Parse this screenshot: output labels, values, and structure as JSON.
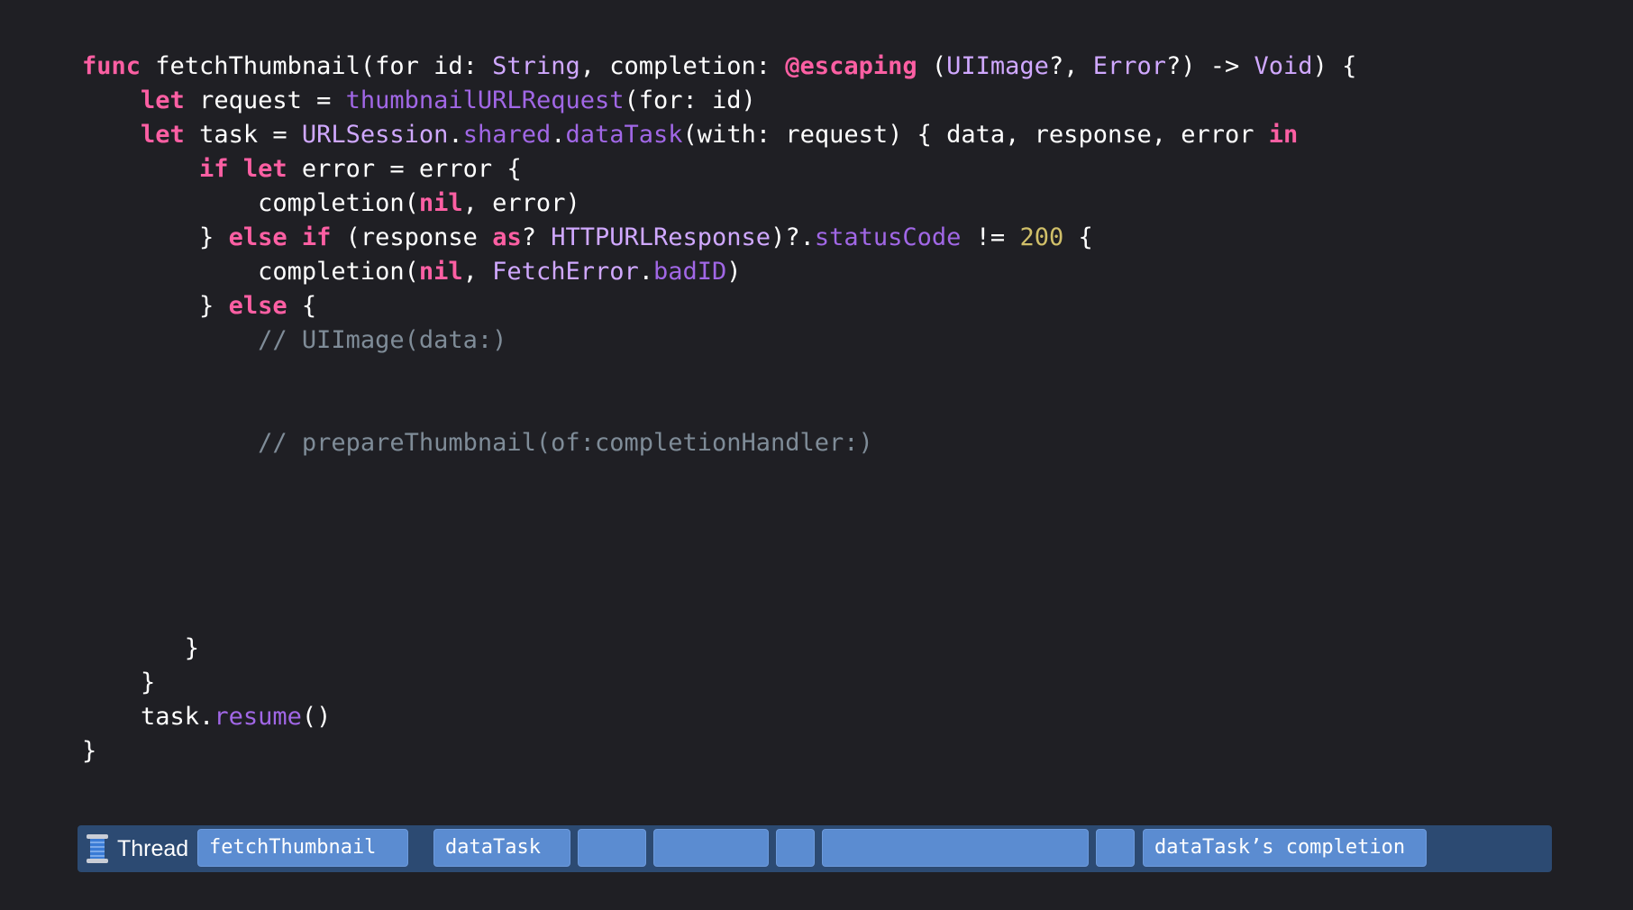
{
  "code_lines": [
    [
      [
        "kw",
        "func"
      ],
      [
        "pl",
        " fetchThumbnail(for id: "
      ],
      [
        "ty",
        "String"
      ],
      [
        "pl",
        ", completion: "
      ],
      [
        "kw",
        "@escaping"
      ],
      [
        "pl",
        " ("
      ],
      [
        "ty",
        "UIImage"
      ],
      [
        "pl",
        "?, "
      ],
      [
        "ty",
        "Error"
      ],
      [
        "pl",
        "?) -> "
      ],
      [
        "ty",
        "Void"
      ],
      [
        "pl",
        ") {"
      ]
    ],
    [
      [
        "pl",
        "    "
      ],
      [
        "kw",
        "let"
      ],
      [
        "pl",
        " request = "
      ],
      [
        "fn",
        "thumbnailURLRequest"
      ],
      [
        "pl",
        "(for: id)"
      ]
    ],
    [
      [
        "pl",
        "    "
      ],
      [
        "kw",
        "let"
      ],
      [
        "pl",
        " task = "
      ],
      [
        "ty",
        "URLSession"
      ],
      [
        "pl",
        "."
      ],
      [
        "fn",
        "shared"
      ],
      [
        "pl",
        "."
      ],
      [
        "fn",
        "dataTask"
      ],
      [
        "pl",
        "(with: request) { data, response, error "
      ],
      [
        "kw",
        "in"
      ]
    ],
    [
      [
        "pl",
        "        "
      ],
      [
        "kw",
        "if"
      ],
      [
        "pl",
        " "
      ],
      [
        "kw",
        "let"
      ],
      [
        "pl",
        " error = error {"
      ]
    ],
    [
      [
        "pl",
        "            completion("
      ],
      [
        "kw",
        "nil"
      ],
      [
        "pl",
        ", error)"
      ]
    ],
    [
      [
        "pl",
        "        } "
      ],
      [
        "kw",
        "else"
      ],
      [
        "pl",
        " "
      ],
      [
        "kw",
        "if"
      ],
      [
        "pl",
        " (response "
      ],
      [
        "kw",
        "as"
      ],
      [
        "pl",
        "? "
      ],
      [
        "ty",
        "HTTPURLResponse"
      ],
      [
        "pl",
        ")?."
      ],
      [
        "fn",
        "statusCode"
      ],
      [
        "pl",
        " != "
      ],
      [
        "num",
        "200"
      ],
      [
        "pl",
        " {"
      ]
    ],
    [
      [
        "pl",
        "            completion("
      ],
      [
        "kw",
        "nil"
      ],
      [
        "pl",
        ", "
      ],
      [
        "ty",
        "FetchError"
      ],
      [
        "pl",
        "."
      ],
      [
        "fn",
        "badID"
      ],
      [
        "pl",
        ")"
      ]
    ],
    [
      [
        "pl",
        "        } "
      ],
      [
        "kw",
        "else"
      ],
      [
        "pl",
        " {"
      ]
    ],
    [
      [
        "cm",
        "            // UIImage(data:)"
      ]
    ],
    [
      [
        "cm",
        "            // prepareThumbnail(of:completionHandler:)"
      ]
    ],
    [
      [
        "pl",
        "       }"
      ]
    ],
    [
      [
        "pl",
        "    }"
      ]
    ],
    [
      [
        "pl",
        "    task."
      ],
      [
        "fn",
        "resume"
      ],
      [
        "pl",
        "()"
      ]
    ],
    [
      [
        "pl",
        "}"
      ]
    ]
  ],
  "thread_bar": {
    "label": "Thread",
    "icon": "spool-icon",
    "segments": [
      {
        "label": "fetchThumbnail"
      },
      {
        "label": "dataTask"
      },
      {
        "label": ""
      },
      {
        "label": ""
      },
      {
        "label": ""
      },
      {
        "label": ""
      },
      {
        "label": ""
      },
      {
        "label": "dataTask’s completion"
      }
    ]
  },
  "colors": {
    "background": "#1f1f24",
    "keyword": "#fc5fa3",
    "type": "#d0a8ff",
    "function": "#a167e6",
    "number": "#d0bf69",
    "comment": "#7f8c98",
    "thread_bar": "#2c4a72",
    "segment": "#5b8cd1"
  }
}
